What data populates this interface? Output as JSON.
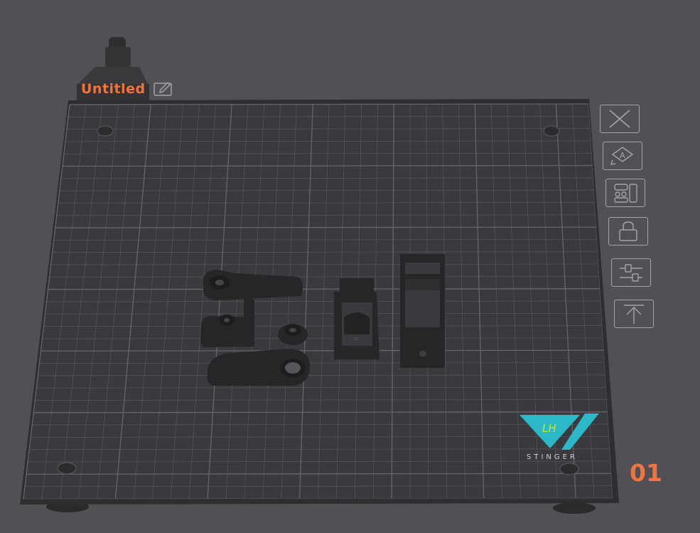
{
  "plate": {
    "title": "Untitled",
    "number": "01"
  },
  "brand": {
    "name": "STINGER",
    "logo_mark": "LH",
    "accent": "#2bb8c8",
    "logo_text_color": "#c8e832"
  },
  "colors": {
    "background": "#505055",
    "plate_surface": "#3a3a3e",
    "grid_line": "#6a6a70",
    "accent": "#f2743d",
    "tool_icon": "#a3a3a8",
    "part": "#2a2a2c"
  },
  "tools": [
    {
      "name": "remove-plate",
      "icon": "close-icon"
    },
    {
      "name": "auto-orient",
      "icon": "auto-orient-icon"
    },
    {
      "name": "arrange",
      "icon": "arrange-icon"
    },
    {
      "name": "lock-plate",
      "icon": "lock-icon"
    },
    {
      "name": "plate-settings",
      "icon": "sliders-icon"
    },
    {
      "name": "move-to-top",
      "icon": "move-top-icon"
    }
  ]
}
